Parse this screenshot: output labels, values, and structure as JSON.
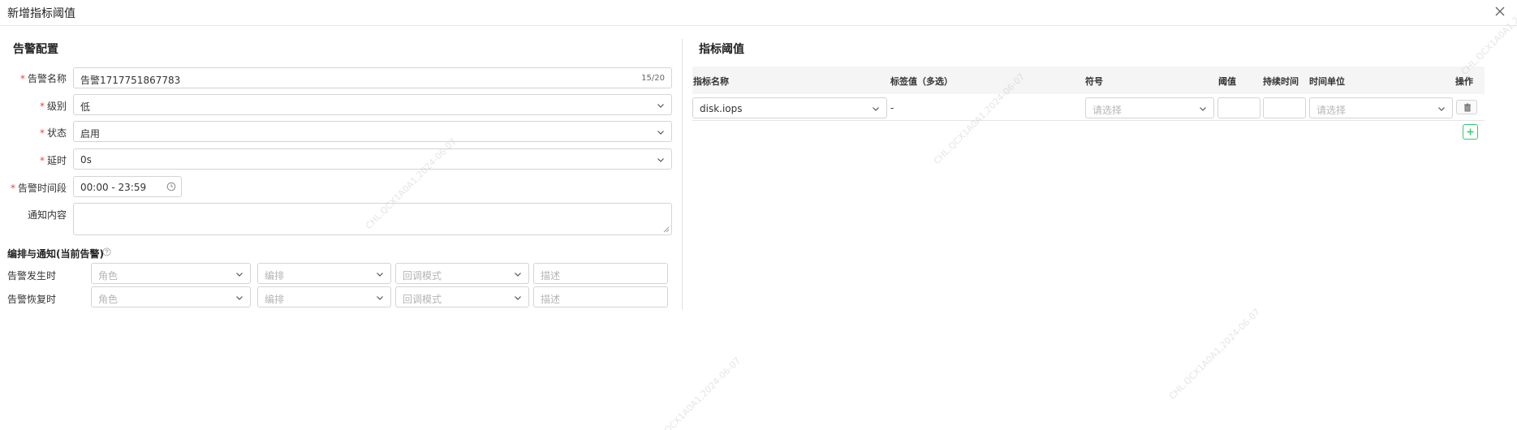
{
  "dialog": {
    "title": "新增指标阈值"
  },
  "alert_config": {
    "heading": "告警配置",
    "fields": {
      "name": {
        "label": "告警名称",
        "value": "告警1717751867783",
        "count": "15/20"
      },
      "level": {
        "label": "级别",
        "value": "低"
      },
      "status": {
        "label": "状态",
        "value": "启用"
      },
      "delay": {
        "label": "延时",
        "value": "0s"
      },
      "time_range": {
        "label": "告警时间段",
        "value": "00:00 - 23:59"
      },
      "notify_content": {
        "label": "通知内容",
        "value": ""
      }
    }
  },
  "orchestration": {
    "heading": "编排与通知(当前告警)",
    "rows": [
      {
        "label": "告警发生时",
        "role_placeholder": "角色",
        "schedule_placeholder": "编排",
        "callback_placeholder": "回调模式",
        "desc_placeholder": "描述"
      },
      {
        "label": "告警恢复时",
        "role_placeholder": "角色",
        "schedule_placeholder": "编排",
        "callback_placeholder": "回调模式",
        "desc_placeholder": "描述"
      }
    ]
  },
  "threshold": {
    "heading": "指标阈值",
    "columns": {
      "metric_name": "指标名称",
      "tag_values": "标签值（多选）",
      "symbol": "符号",
      "threshold": "阈值",
      "duration": "持续时间",
      "time_unit": "时间单位",
      "actions": "操作"
    },
    "rows": [
      {
        "metric": "disk.iops",
        "tags": "-",
        "symbol_placeholder": "请选择",
        "threshold": "",
        "duration": "",
        "time_unit_placeholder": "请选择"
      }
    ]
  },
  "watermark": {
    "text": "CHL.QCX1A0A1,2024-06-07"
  },
  "colors": {
    "accent_underline": "#bfe9f2",
    "required": "#e74c3c",
    "add_button": "#2ecc71"
  }
}
